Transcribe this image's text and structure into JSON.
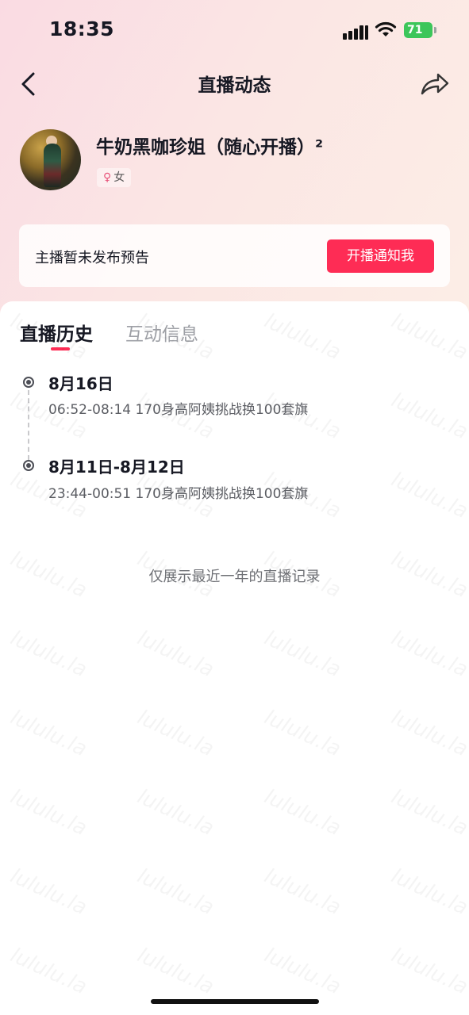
{
  "status_bar": {
    "time": "18:35",
    "battery": "71"
  },
  "nav": {
    "title": "直播动态"
  },
  "profile": {
    "name": "牛奶黑咖珍姐（随心开播）²",
    "gender": "女"
  },
  "notice": {
    "text": "主播暂未发布预告",
    "button": "开播通知我"
  },
  "tabs": [
    {
      "label": "直播历史",
      "active": true
    },
    {
      "label": "互动信息",
      "active": false
    }
  ],
  "records": [
    {
      "date": "8月16日",
      "desc": "06:52-08:14 170身高阿姨挑战换100套旗"
    },
    {
      "date": "8月11日-8月12日",
      "desc": "23:44-00:51 170身高阿姨挑战换100套旗"
    }
  ],
  "footer_note": "仅展示最近一年的直播记录",
  "watermark": "lululu.la",
  "colors": {
    "accent": "#fe2c55",
    "battery": "#3cc65a"
  }
}
